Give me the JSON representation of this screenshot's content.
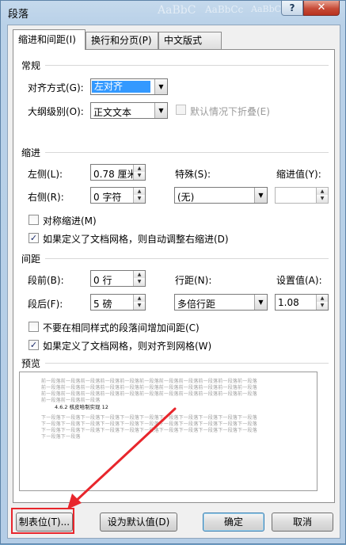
{
  "window": {
    "title": "段落",
    "ghost_text": [
      "AaBbC",
      "AaBbCc",
      "AaBbCcD",
      "AaBbCcD"
    ],
    "help_glyph": "?",
    "close_glyph": "✕"
  },
  "tabs": [
    {
      "label": "缩进和间距(I)",
      "active": true
    },
    {
      "label": "换行和分页(P)",
      "active": false
    },
    {
      "label": "中文版式(H)",
      "active": false
    }
  ],
  "general": {
    "section_label": "常规",
    "alignment_label": "对齐方式(G):",
    "alignment_value": "左对齐",
    "outline_label": "大纲级别(O):",
    "outline_value": "正文文本",
    "collapse_label": "默认情况下折叠(E)"
  },
  "indent": {
    "section_label": "缩进",
    "left_label": "左侧(L):",
    "left_value": "0.78 厘米",
    "right_label": "右侧(R):",
    "right_value": "0 字符",
    "special_label": "特殊(S):",
    "special_value": "(无)",
    "indent_value_label": "缩进值(Y):",
    "indent_value": "",
    "mirror_label": "对称缩进(M)",
    "auto_adjust_label": "如果定义了文档网格，则自动调整右缩进(D)"
  },
  "spacing": {
    "section_label": "间距",
    "before_label": "段前(B):",
    "before_value": "0 行",
    "after_label": "段后(F):",
    "after_value": "5 磅",
    "line_spacing_label": "行距(N):",
    "line_spacing_value": "多倍行距",
    "at_label": "设置值(A):",
    "at_value": "1.08",
    "no_space_label": "不要在相同样式的段落间增加间距(C)",
    "snap_grid_label": "如果定义了文档网格，则对齐到网格(W)"
  },
  "preview": {
    "section_label": "预览",
    "prev_lines": [
      "前一段落前一段落前一段落前一段落前一段落前一段落前一段落前一段落前一段落前一段落前一段落",
      "前一段落前一段落前一段落前一段落前一段落前一段落前一段落前一段落前一段落前一段落前一段落",
      "前一段落前一段落前一段落前一段落前一段落前一段落前一段落前一段落前一段落前一段落前一段落",
      "前一段落前一段落前一段落"
    ],
    "sample_text": "4.6.2   核皮哈制实现    12",
    "next_lines": [
      "下一段落下一段落下一段落下一段落下一段落下一段落下一段落下一段落下一段落下一段落下一段落",
      "下一段落下一段落下一段落下一段落下一段落下一段落下一段落下一段落下一段落下一段落下一段落",
      "下一段落下一段落下一段落下一段落下一段落下一段落下一段落下一段落下一段落下一段落下一段落",
      "下一段落下一段落"
    ]
  },
  "buttons": {
    "tabs": "制表位(T)...",
    "set_default": "设为默认值(D)",
    "ok": "确定",
    "cancel": "取消"
  },
  "colors": {
    "annotation_red": "#e8262c",
    "selection_blue": "#3399ff"
  }
}
